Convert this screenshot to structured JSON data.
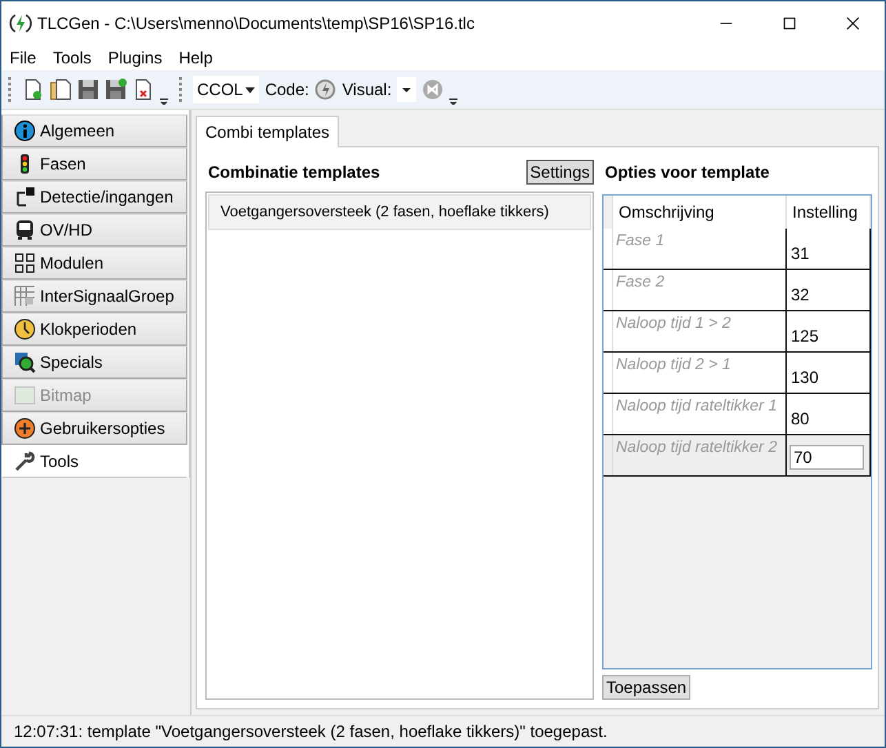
{
  "window": {
    "title": "TLCGen - C:\\Users\\menno\\Documents\\temp\\SP16\\SP16.tlc"
  },
  "menu": [
    "File",
    "Tools",
    "Plugins",
    "Help"
  ],
  "toolbar": {
    "generator": "CCOL",
    "code_label": "Code:",
    "visual_label": "Visual:"
  },
  "sidebar": {
    "items": [
      {
        "label": "Algemeen",
        "selected": false,
        "disabled": false
      },
      {
        "label": "Fasen",
        "selected": false,
        "disabled": false
      },
      {
        "label": "Detectie/ingangen",
        "selected": false,
        "disabled": false
      },
      {
        "label": "OV/HD",
        "selected": false,
        "disabled": false
      },
      {
        "label": "Modulen",
        "selected": false,
        "disabled": false
      },
      {
        "label": "InterSignaalGroep",
        "selected": false,
        "disabled": false
      },
      {
        "label": "Klokperioden",
        "selected": false,
        "disabled": false
      },
      {
        "label": "Specials",
        "selected": false,
        "disabled": false
      },
      {
        "label": "Bitmap",
        "selected": false,
        "disabled": true
      },
      {
        "label": "Gebruikersopties",
        "selected": false,
        "disabled": false
      },
      {
        "label": "Tools",
        "selected": true,
        "disabled": false
      }
    ]
  },
  "tabs": [
    {
      "label": "Combi templates",
      "selected": true
    }
  ],
  "templates": {
    "title": "Combinatie templates",
    "settings_button": "Settings",
    "items": [
      {
        "label": "Voetgangersoversteek (2 fasen, hoeflake tikkers)",
        "selected": true
      }
    ]
  },
  "options": {
    "title": "Opties voor template",
    "columns": [
      "Omschrijving",
      "Instelling"
    ],
    "rows": [
      {
        "description": "Fase 1",
        "value": "31",
        "selected": false
      },
      {
        "description": "Fase 2",
        "value": "32",
        "selected": false
      },
      {
        "description": "Naloop tijd 1 > 2",
        "value": "125",
        "selected": false
      },
      {
        "description": "Naloop tijd 2 > 1",
        "value": "130",
        "selected": false
      },
      {
        "description": "Naloop tijd rateltikker 1",
        "value": "80",
        "selected": false
      },
      {
        "description": "Naloop tijd rateltikker 2",
        "value": "70",
        "selected": true
      }
    ],
    "apply_button": "Toepassen"
  },
  "status_bar": "12:07:31: template \"Voetgangersoversteek (2 fasen, hoeflake tikkers)\" toegepast."
}
